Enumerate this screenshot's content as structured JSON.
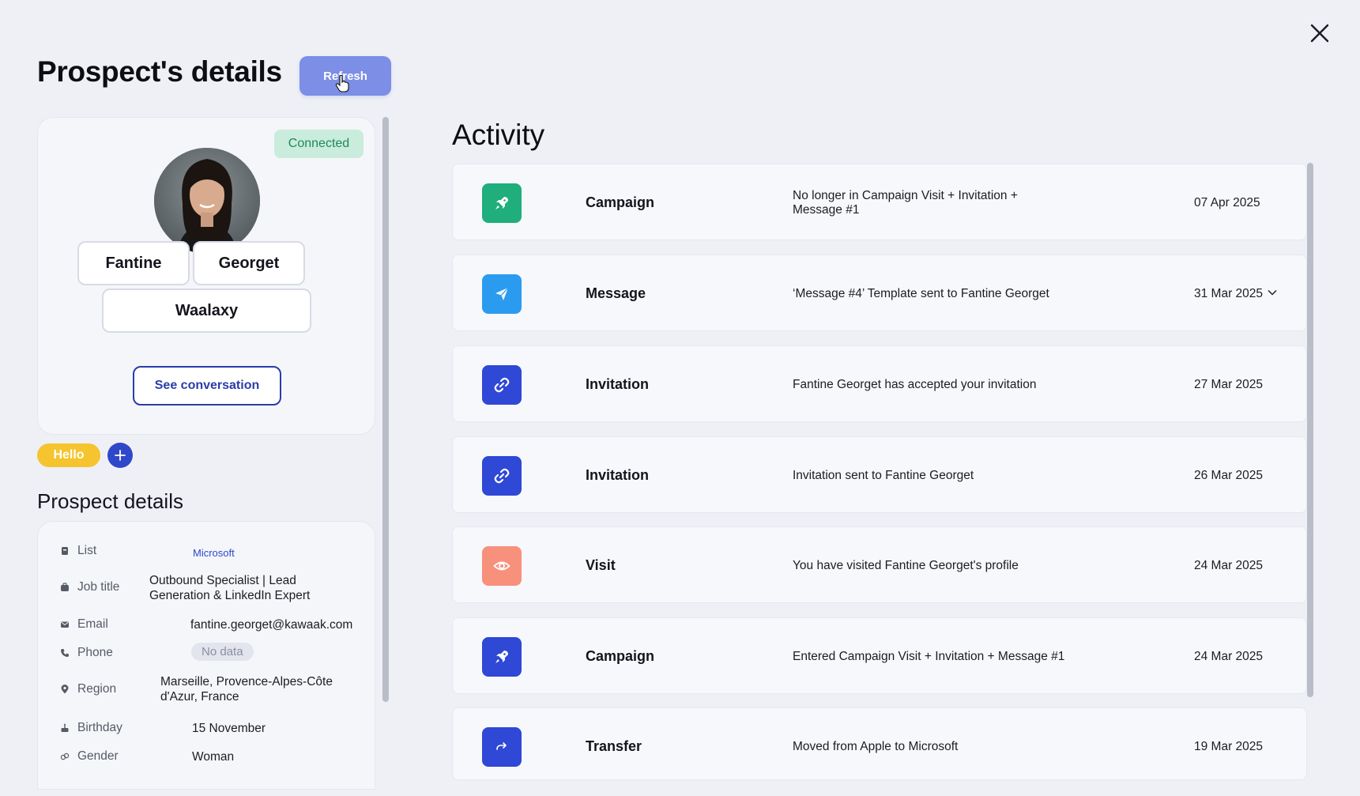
{
  "header": {
    "title": "Prospect's details",
    "refresh_label": "Refresh"
  },
  "profile": {
    "status": "Connected",
    "first_name": "Fantine",
    "last_name": "Georget",
    "company": "Waalaxy",
    "see_conversation_label": "See conversation",
    "tags": [
      "Hello"
    ],
    "add_tag_label": "+"
  },
  "prospect_details": {
    "title": "Prospect details",
    "rows": [
      {
        "label": "List",
        "value": "Microsoft",
        "icon": "list-icon"
      },
      {
        "label": "Job title",
        "value": "Outbound Specialist | Lead Generation & LinkedIn Expert",
        "icon": "briefcase-icon"
      },
      {
        "label": "Email",
        "value": "fantine.georget@kawaak.com",
        "icon": "mail-icon"
      },
      {
        "label": "Phone",
        "value": "No data",
        "icon": "phone-icon"
      },
      {
        "label": "Region",
        "value": "Marseille, Provence-Alpes-Côte d'Azur, France",
        "icon": "pin-icon"
      },
      {
        "label": "Birthday",
        "value": "15 November",
        "icon": "cake-icon"
      },
      {
        "label": "Gender",
        "value": "Woman",
        "icon": "gender-icon"
      }
    ]
  },
  "activity": {
    "title": "Activity",
    "items": [
      {
        "type": "Campaign",
        "desc": "No longer in Campaign Visit + Invitation + Message #1",
        "date": "07 Apr 2025",
        "icon": "rocket-icon",
        "color": "#1fae7c"
      },
      {
        "type": "Message",
        "desc": "‘Message #4’ Template sent to Fantine Georget",
        "date": "31 Mar 2025",
        "icon": "send-icon",
        "color": "#2b9bf0"
      },
      {
        "type": "Invitation",
        "desc": "Fantine Georget has accepted your invitation",
        "date": "27 Mar 2025",
        "icon": "link-icon",
        "color": "#2f48d6"
      },
      {
        "type": "Invitation",
        "desc": "Invitation sent to Fantine Georget",
        "date": "26 Mar 2025",
        "icon": "link-icon",
        "color": "#2f48d6"
      },
      {
        "type": "Visit",
        "desc": "You have visited Fantine Georget's profile",
        "date": "24 Mar 2025",
        "icon": "eye-icon",
        "color": "#f7917c"
      },
      {
        "type": "Campaign",
        "desc": "Entered Campaign Visit + Invitation + Message #1",
        "date": "24 Mar 2025",
        "icon": "rocket-icon",
        "color": "#2f48d6"
      },
      {
        "type": "Transfer",
        "desc": "Moved from Apple to Microsoft",
        "date": "19 Mar 2025",
        "icon": "arrow-right-icon",
        "color": "#2f48d6"
      }
    ]
  }
}
